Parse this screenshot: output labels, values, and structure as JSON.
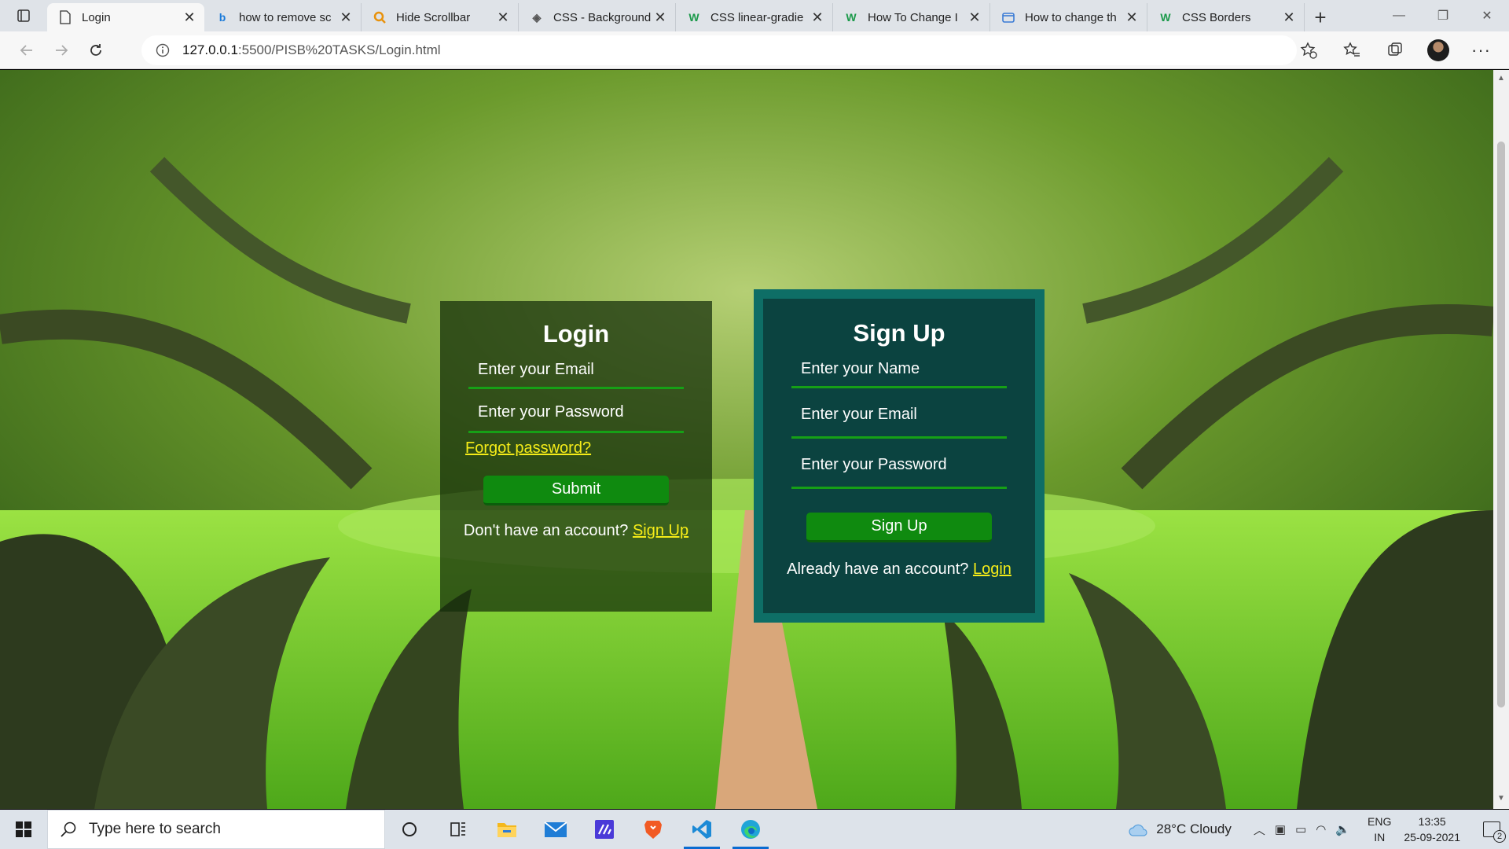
{
  "browser": {
    "tabs": [
      {
        "title": "Login",
        "icon": "page-icon",
        "active": true
      },
      {
        "title": "how to remove sc",
        "icon": "bing-icon"
      },
      {
        "title": "Hide Scrollbar",
        "icon": "search-favicon-icon"
      },
      {
        "title": "CSS - Background",
        "icon": "diamond-icon"
      },
      {
        "title": "CSS linear-gradie",
        "icon": "w3schools-icon"
      },
      {
        "title": "How To Change I",
        "icon": "w3schools-icon"
      },
      {
        "title": "How to change th",
        "icon": "tab-favicon-icon"
      },
      {
        "title": "CSS Borders",
        "icon": "w3schools-icon"
      }
    ],
    "url_host": "127.0.0.1",
    "url_path": ":5500/PISB%20TASKS/Login.html"
  },
  "login": {
    "title": "Login",
    "email_placeholder": "Enter your Email",
    "password_placeholder": "Enter your Password",
    "forgot": "Forgot password?",
    "submit": "Submit",
    "alt_text": "Don't have an account?",
    "alt_link": "Sign Up"
  },
  "signup": {
    "title": "Sign Up",
    "name_placeholder": "Enter your Name",
    "email_placeholder": "Enter your Email",
    "password_placeholder": "Enter your Password",
    "submit": "Sign Up",
    "alt_text": "Already have an account?",
    "alt_link": "Login"
  },
  "taskbar": {
    "search_placeholder": "Type here to search",
    "weather": "28°C  Cloudy",
    "lang_line1": "ENG",
    "lang_line2": "IN",
    "time": "13:35",
    "date": "25-09-2021",
    "notification_count": "2"
  },
  "colors": {
    "accent_green": "#0f8a0f",
    "link_yellow": "#f5ec18",
    "signup_border": "#0e6e66",
    "signup_bg": "#0b4340"
  }
}
